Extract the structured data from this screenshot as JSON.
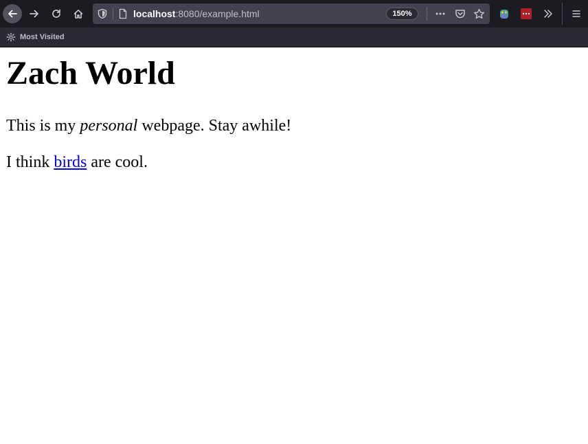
{
  "browser": {
    "url_host": "localhost",
    "url_path": ":8080/example.html",
    "zoom_level": "150%",
    "bookmarks": [
      {
        "label": "Most Visited",
        "icon": "gear-icon"
      }
    ],
    "colors": {
      "toolbar": "#1c1b22",
      "urlbar": "#42414d",
      "bookmarks_bar": "#2b2a33",
      "text_light": "#fbfbfe"
    }
  },
  "page": {
    "heading": "Zach World",
    "paragraph_1": {
      "before": "This is my ",
      "emphasis": "personal",
      "after": " webpage. Stay awhile!"
    },
    "paragraph_2": {
      "before": "I think ",
      "link_text": "birds",
      "after": " are cool."
    },
    "colors": {
      "link": "#0000ee",
      "text": "#000000",
      "background": "#ffffff"
    }
  }
}
